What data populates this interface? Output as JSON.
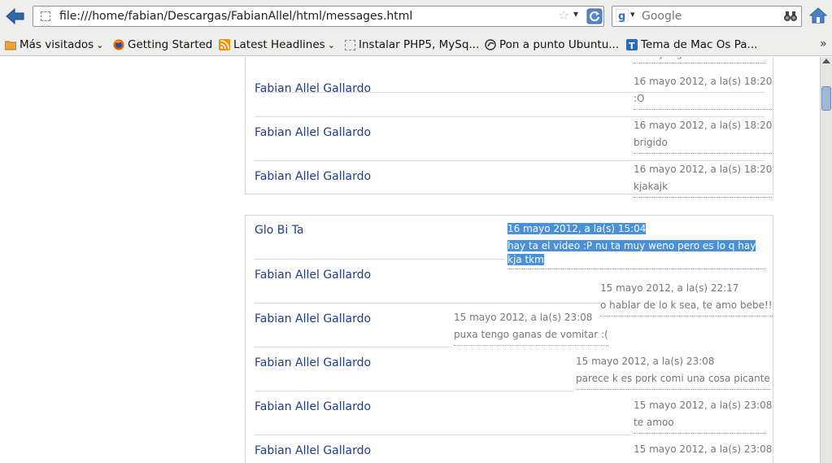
{
  "browser": {
    "url": "file:///home/fabian/Descargas/FabianAllel/html/messages.html",
    "search_placeholder": "Google",
    "bookmarks": [
      {
        "label": "Más visitados",
        "icon": "folder-icon",
        "dropdown": true
      },
      {
        "label": "Getting Started",
        "icon": "firefox-icon"
      },
      {
        "label": "Latest Headlines",
        "icon": "rss-icon",
        "dropdown": true
      },
      {
        "label": "Instalar PHP5, MySq...",
        "icon": "blank-page-icon"
      },
      {
        "label": "Pon a punto Ubuntu...",
        "icon": "site-icon"
      },
      {
        "label": "Tema de Mac Os Pa...",
        "icon": "t-icon"
      }
    ],
    "more_bookmarks": "»"
  },
  "thread1": {
    "top_message": "no tay logi?",
    "rows": [
      {
        "author": "Fabian Allel Gallardo",
        "date": "16 mayo 2012, a la(s) 18:20",
        "message": ":O"
      },
      {
        "author": "Fabian Allel Gallardo",
        "date": "16 mayo 2012, a la(s) 18:20",
        "message": "brigido"
      },
      {
        "author": "Fabian Allel Gallardo",
        "date": "16 mayo 2012, a la(s) 18:20",
        "message": "kjakajk"
      }
    ]
  },
  "thread2": {
    "rows": [
      {
        "author": "Glo Bi Ta",
        "date": "16 mayo 2012, a la(s) 15:04",
        "message": "hay ta el video :P nu ta muy weno pero es lo q hay kja tkm"
      },
      {
        "author": "Fabian Allel Gallardo",
        "date": "15 mayo 2012, a la(s) 22:17",
        "message": "o hablar de lo k sea, te amo bebe!!"
      },
      {
        "author": "Fabian Allel Gallardo",
        "date": "15 mayo 2012, a la(s) 23:08",
        "message": "puxa tengo ganas de vomitar :("
      },
      {
        "author": "Fabian Allel Gallardo",
        "date": "15 mayo 2012, a la(s) 23:08",
        "message": "parece k es pork comi una cosa picante"
      },
      {
        "author": "Fabian Allel Gallardo",
        "date": "15 mayo 2012, a la(s) 23:08",
        "message": "te amoo"
      },
      {
        "author": "Fabian Allel Gallardo",
        "date": "15 mayo 2012, a la(s) 23:08",
        "message": ""
      }
    ]
  },
  "colors": {
    "author": "#1f3c8c",
    "selection": "#4a90d9",
    "meta_text": "#777777"
  }
}
